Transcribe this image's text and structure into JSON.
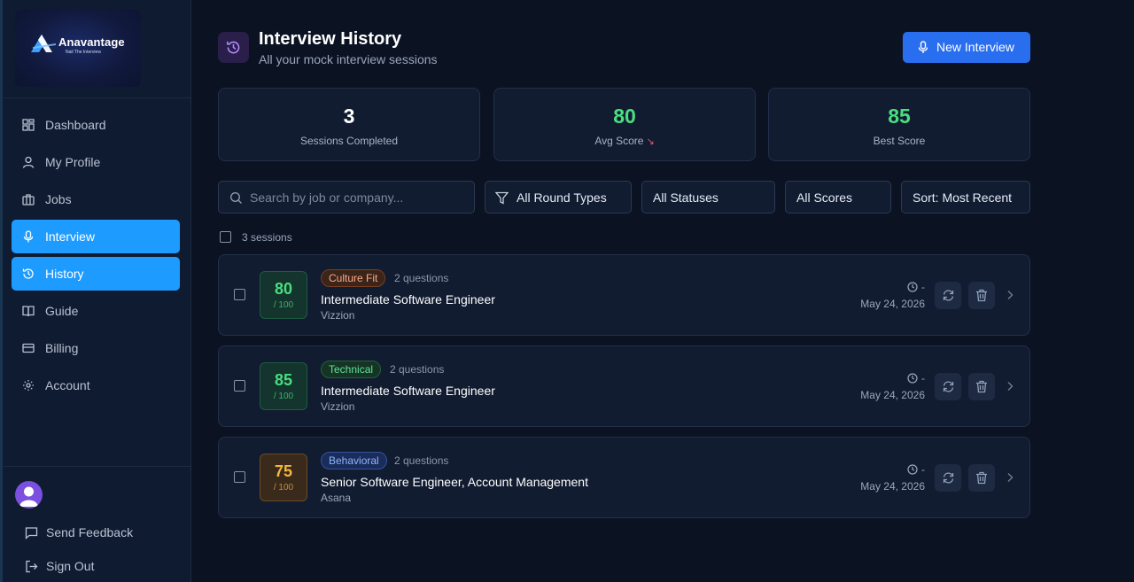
{
  "brand": {
    "name": "Anavantage",
    "tagline": "Nail The Interview"
  },
  "sidebar": {
    "items": [
      {
        "label": "Dashboard",
        "icon": "dashboard-icon",
        "active": false
      },
      {
        "label": "My Profile",
        "icon": "user-icon",
        "active": false
      },
      {
        "label": "Jobs",
        "icon": "briefcase-icon",
        "active": false
      },
      {
        "label": "Interview",
        "icon": "microphone-icon",
        "active": true
      },
      {
        "label": "History",
        "icon": "history-icon",
        "active": true
      },
      {
        "label": "Guide",
        "icon": "book-icon",
        "active": false
      },
      {
        "label": "Billing",
        "icon": "credit-card-icon",
        "active": false
      },
      {
        "label": "Account",
        "icon": "gear-icon",
        "active": false
      }
    ],
    "footer": {
      "feedback": "Send Feedback",
      "signout": "Sign Out"
    }
  },
  "header": {
    "title": "Interview History",
    "subtitle": "All your mock interview sessions",
    "new_button": "New Interview"
  },
  "stats": [
    {
      "value": "3",
      "label": "Sessions Completed",
      "color": "#ffffff"
    },
    {
      "value": "80",
      "label": "Avg Score",
      "trend": "↘",
      "color": "#4ade80"
    },
    {
      "value": "85",
      "label": "Best Score",
      "color": "#4ade80"
    }
  ],
  "filters": {
    "search_placeholder": "Search by job or company...",
    "round_type": "All Round Types",
    "status": "All Statuses",
    "scores": "All Scores",
    "sort": "Sort: Most Recent"
  },
  "list": {
    "count_label": "3 sessions",
    "sessions": [
      {
        "score": "80",
        "out_of": "/ 100",
        "round": "Culture Fit",
        "questions": "2 questions",
        "title": "Intermediate Software Engineer",
        "company": "Vizzion",
        "duration": "-",
        "date": "May 24, 2026"
      },
      {
        "score": "85",
        "out_of": "/ 100",
        "round": "Technical",
        "questions": "2 questions",
        "title": "Intermediate Software Engineer",
        "company": "Vizzion",
        "duration": "-",
        "date": "May 24, 2026"
      },
      {
        "score": "75",
        "out_of": "/ 100",
        "round": "Behavioral",
        "questions": "2 questions",
        "title": "Senior Software Engineer, Account Management",
        "company": "Asana",
        "duration": "-",
        "date": "May 24, 2026"
      }
    ]
  },
  "colors": {
    "accent": "#1e9bff",
    "primary_button": "#2a6ef0",
    "score_good": "#4ade80",
    "score_mid": "#f4b740"
  }
}
